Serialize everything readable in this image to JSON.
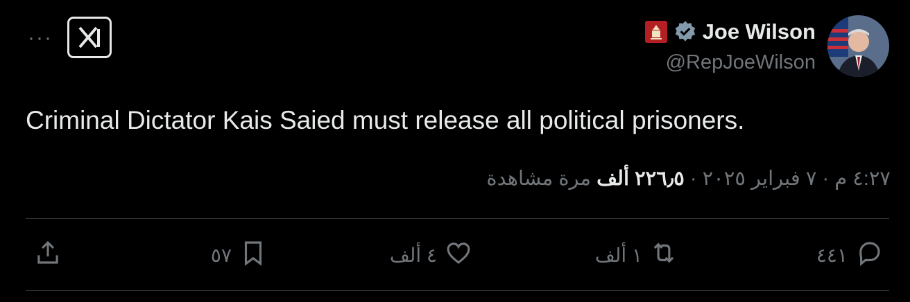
{
  "author": {
    "name": "Joe Wilson",
    "handle": "@RepJoeWilson",
    "avatar_icon": "avatar",
    "verified_icon": "verified-badge-icon",
    "affiliation_icon": "us-house-flag-icon"
  },
  "header": {
    "more_icon": "more-icon",
    "more_label": "···",
    "logo_icon": "x-logo-icon"
  },
  "tweet": {
    "text": "Criminal Dictator Kais Saied must release all political prisoners."
  },
  "meta": {
    "time": "٤:٢٧ م",
    "date": "٧ فبراير ٢٠٢٥",
    "views_count": "٢٢٦٫٥ ألف",
    "views_label": "مرة مشاهدة",
    "separator": "·"
  },
  "actions": {
    "reply": {
      "count": "٤٤١",
      "icon": "reply-icon"
    },
    "retweet": {
      "count": "١ ألف",
      "icon": "retweet-icon"
    },
    "like": {
      "count": "٤ ألف",
      "icon": "heart-icon"
    },
    "bookmark": {
      "count": "٥٧",
      "icon": "bookmark-icon"
    },
    "share": {
      "icon": "share-icon"
    }
  },
  "colors": {
    "background": "#000000",
    "text": "#e7e9ea",
    "secondary": "#71767b",
    "divider": "#2f3336",
    "verified": "#829aab",
    "badge_red": "#b41f24"
  }
}
